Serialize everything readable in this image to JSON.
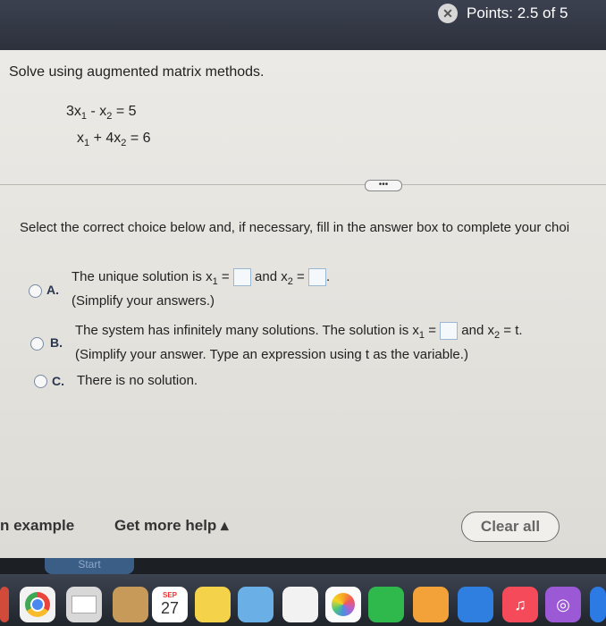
{
  "header": {
    "points_label": "Points: 2.5 of 5",
    "points_icon": "partial-credit-icon"
  },
  "question": {
    "prompt": "Solve using augmented matrix methods.",
    "eq1_left": "3x",
    "eq1_sub1": "1",
    "eq1_mid": " - x",
    "eq1_sub2": "2",
    "eq1_right": " =  5",
    "eq2_left": "x",
    "eq2_sub1": "1",
    "eq2_mid": " + 4x",
    "eq2_sub2": "2",
    "eq2_right": " =  6"
  },
  "more_label": "•••",
  "instruction": "Select the correct choice below and, if necessary, fill in the answer box to complete your choi",
  "choices": {
    "a": {
      "letter": "A.",
      "line1_start": "The unique solution is x",
      "sub1": "1",
      "eq": " = ",
      "and": " and x",
      "sub2": "2",
      "eq2": " = ",
      "end": ".",
      "line2": "(Simplify your answers.)"
    },
    "b": {
      "letter": "B.",
      "line1_start": "The system has infinitely many solutions. The solution is x",
      "sub1": "1",
      "eq": " = ",
      "and": " and x",
      "sub2": "2",
      "end": " = t.",
      "line2": "(Simplify your answer. Type an expression using t as the variable.)"
    },
    "c": {
      "letter": "C.",
      "line1": "There is no solution."
    }
  },
  "footer": {
    "example": "n example",
    "help": "Get more help ▴",
    "clear": "Clear all",
    "start": "Start"
  },
  "dock": {
    "calendar_month": "SEP",
    "calendar_day": "27"
  }
}
